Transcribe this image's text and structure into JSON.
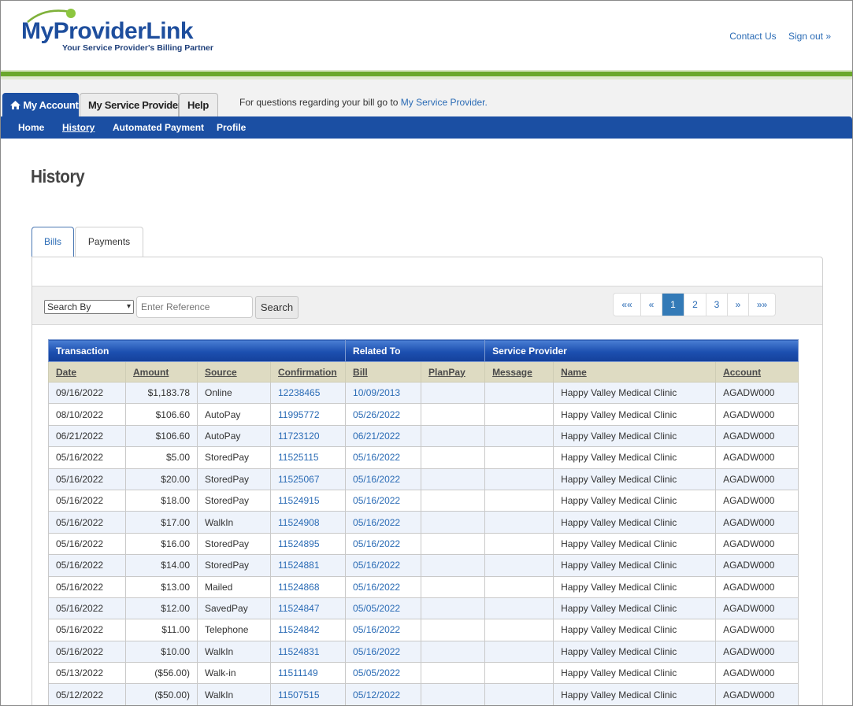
{
  "brand": {
    "name": "MyProviderLink",
    "tagline": "Your Service Provider's Billing Partner"
  },
  "header_links": {
    "contact": "Contact Us",
    "signout": "Sign out »"
  },
  "top_tabs": {
    "my_account": "My Account",
    "my_service_provider": "My Service Provider",
    "help": "Help"
  },
  "tab_note": {
    "text": "For questions regarding your bill go to ",
    "link": "My Service Provider."
  },
  "nav": {
    "home": "Home",
    "history": "History",
    "automated_payment": "Automated Payment",
    "profile": "Profile"
  },
  "page_title": "History",
  "sub_tabs": {
    "bills": "Bills",
    "payments": "Payments"
  },
  "search": {
    "select_value": "Search By",
    "placeholder": "Enter Reference",
    "button": "Search"
  },
  "pager": {
    "first": "««",
    "prev": "«",
    "pages": [
      "1",
      "2",
      "3"
    ],
    "current": "1",
    "next": "»",
    "last": "»»"
  },
  "table": {
    "groups": {
      "transaction": "Transaction",
      "related_to": "Related To",
      "service_provider": "Service Provider"
    },
    "columns": {
      "date": "Date",
      "amount": "Amount",
      "source": "Source",
      "confirmation": "Confirmation",
      "bill": "Bill",
      "planpay": "PlanPay",
      "message": "Message",
      "name": "Name",
      "account": "Account"
    },
    "rows": [
      {
        "date": "09/16/2022",
        "amount": "$1,183.78",
        "source": "Online",
        "confirmation": "12238465",
        "bill": "10/09/2013",
        "planpay": "",
        "message": "",
        "name": "Happy Valley Medical Clinic",
        "account": "AGADW000"
      },
      {
        "date": "08/10/2022",
        "amount": "$106.60",
        "source": "AutoPay",
        "confirmation": "11995772",
        "bill": "05/26/2022",
        "planpay": "",
        "message": "",
        "name": "Happy Valley Medical Clinic",
        "account": "AGADW000"
      },
      {
        "date": "06/21/2022",
        "amount": "$106.60",
        "source": "AutoPay",
        "confirmation": "11723120",
        "bill": "06/21/2022",
        "planpay": "",
        "message": "",
        "name": "Happy Valley Medical Clinic",
        "account": "AGADW000"
      },
      {
        "date": "05/16/2022",
        "amount": "$5.00",
        "source": "StoredPay",
        "confirmation": "11525115",
        "bill": "05/16/2022",
        "planpay": "",
        "message": "",
        "name": "Happy Valley Medical Clinic",
        "account": "AGADW000"
      },
      {
        "date": "05/16/2022",
        "amount": "$20.00",
        "source": "StoredPay",
        "confirmation": "11525067",
        "bill": "05/16/2022",
        "planpay": "",
        "message": "",
        "name": "Happy Valley Medical Clinic",
        "account": "AGADW000"
      },
      {
        "date": "05/16/2022",
        "amount": "$18.00",
        "source": "StoredPay",
        "confirmation": "11524915",
        "bill": "05/16/2022",
        "planpay": "",
        "message": "",
        "name": "Happy Valley Medical Clinic",
        "account": "AGADW000"
      },
      {
        "date": "05/16/2022",
        "amount": "$17.00",
        "source": "WalkIn",
        "confirmation": "11524908",
        "bill": "05/16/2022",
        "planpay": "",
        "message": "",
        "name": "Happy Valley Medical Clinic",
        "account": "AGADW000"
      },
      {
        "date": "05/16/2022",
        "amount": "$16.00",
        "source": "StoredPay",
        "confirmation": "11524895",
        "bill": "05/16/2022",
        "planpay": "",
        "message": "",
        "name": "Happy Valley Medical Clinic",
        "account": "AGADW000"
      },
      {
        "date": "05/16/2022",
        "amount": "$14.00",
        "source": "StoredPay",
        "confirmation": "11524881",
        "bill": "05/16/2022",
        "planpay": "",
        "message": "",
        "name": "Happy Valley Medical Clinic",
        "account": "AGADW000"
      },
      {
        "date": "05/16/2022",
        "amount": "$13.00",
        "source": "Mailed",
        "confirmation": "11524868",
        "bill": "05/16/2022",
        "planpay": "",
        "message": "",
        "name": "Happy Valley Medical Clinic",
        "account": "AGADW000"
      },
      {
        "date": "05/16/2022",
        "amount": "$12.00",
        "source": "SavedPay",
        "confirmation": "11524847",
        "bill": "05/05/2022",
        "planpay": "",
        "message": "",
        "name": "Happy Valley Medical Clinic",
        "account": "AGADW000"
      },
      {
        "date": "05/16/2022",
        "amount": "$11.00",
        "source": "Telephone",
        "confirmation": "11524842",
        "bill": "05/16/2022",
        "planpay": "",
        "message": "",
        "name": "Happy Valley Medical Clinic",
        "account": "AGADW000"
      },
      {
        "date": "05/16/2022",
        "amount": "$10.00",
        "source": "WalkIn",
        "confirmation": "11524831",
        "bill": "05/16/2022",
        "planpay": "",
        "message": "",
        "name": "Happy Valley Medical Clinic",
        "account": "AGADW000"
      },
      {
        "date": "05/13/2022",
        "amount": "($56.00)",
        "source": "Walk-in",
        "confirmation": "11511149",
        "bill": "05/05/2022",
        "planpay": "",
        "message": "",
        "name": "Happy Valley Medical Clinic",
        "account": "AGADW000"
      },
      {
        "date": "05/12/2022",
        "amount": "($50.00)",
        "source": "WalkIn",
        "confirmation": "11507515",
        "bill": "05/12/2022",
        "planpay": "",
        "message": "",
        "name": "Happy Valley Medical Clinic",
        "account": "AGADW000"
      }
    ]
  },
  "colors": {
    "brand_blue": "#1b4fa3",
    "accent_green": "#6aa72c",
    "link": "#2a6bb5",
    "column_header": "#dedbc2"
  },
  "icons": {
    "my_account": "home-icon"
  }
}
